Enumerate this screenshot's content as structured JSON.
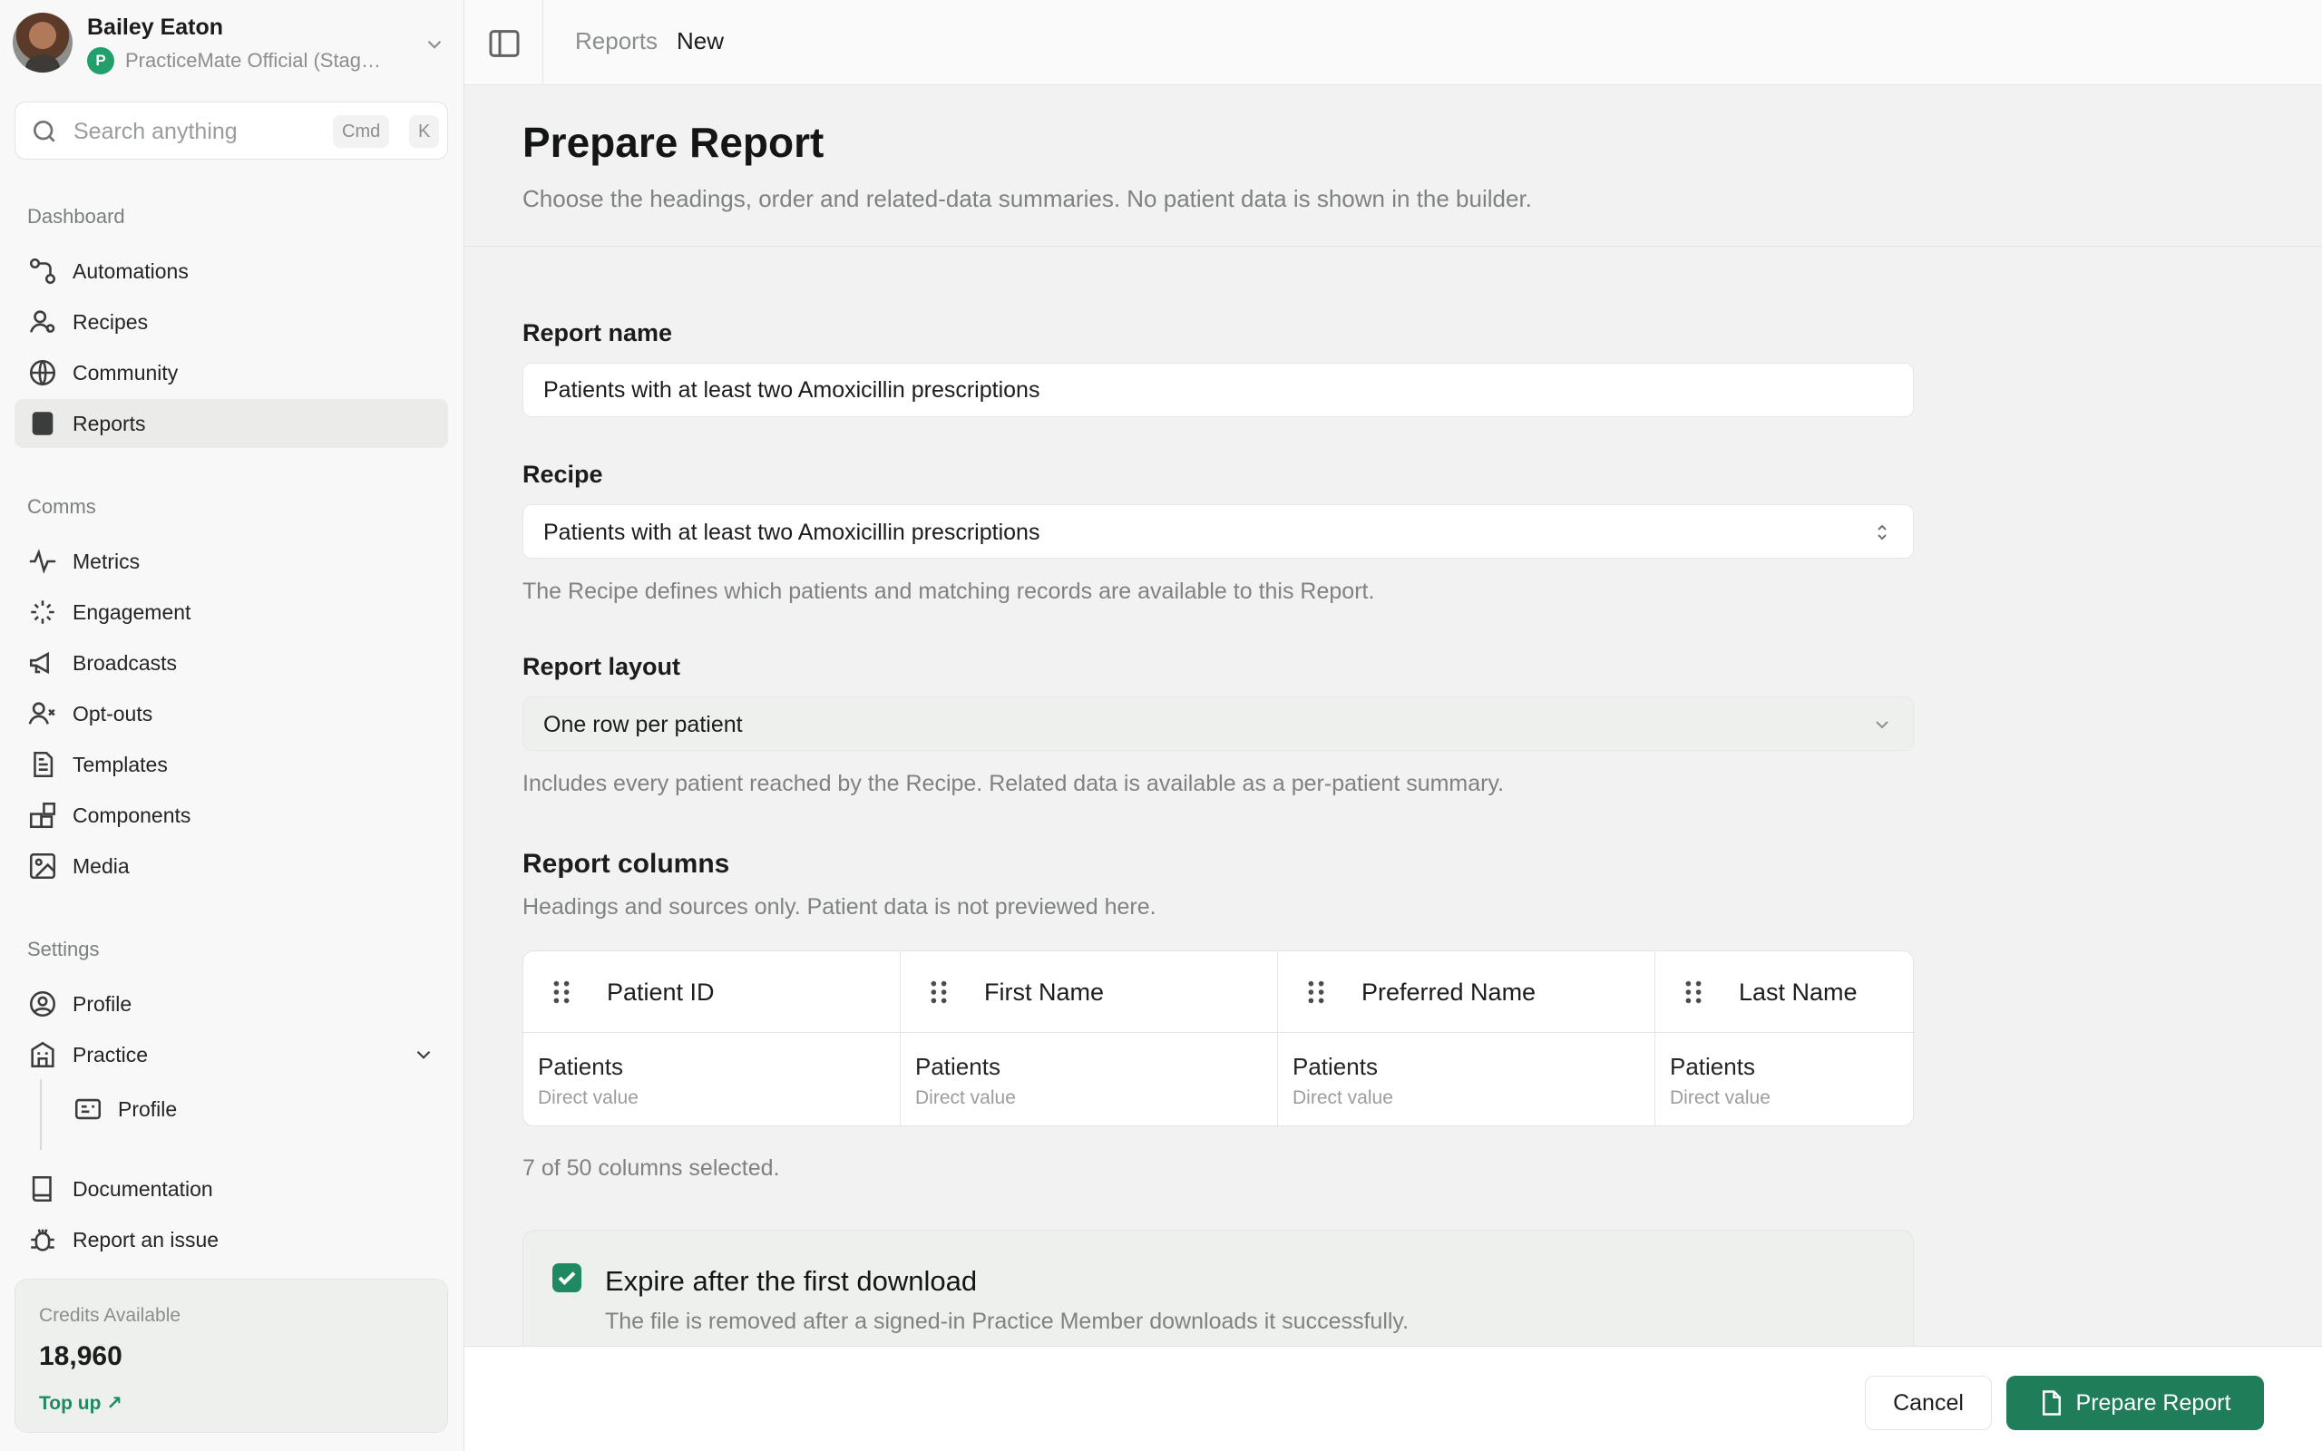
{
  "user": {
    "name": "Bailey Eaton",
    "practice": "PracticeMate Official (Stag…"
  },
  "search": {
    "placeholder": "Search anything",
    "shortcut_mod": "Cmd",
    "shortcut_key": "K"
  },
  "nav": {
    "dashboard_title": "Dashboard",
    "dashboard_items": [
      {
        "label": "Automations",
        "icon": "automations-icon"
      },
      {
        "label": "Recipes",
        "icon": "recipes-icon"
      },
      {
        "label": "Community",
        "icon": "globe-icon"
      },
      {
        "label": "Reports",
        "icon": "reports-icon",
        "active": true
      }
    ],
    "comms_title": "Comms",
    "comms_items": [
      {
        "label": "Metrics",
        "icon": "activity-icon"
      },
      {
        "label": "Engagement",
        "icon": "sparkle-icon"
      },
      {
        "label": "Broadcasts",
        "icon": "megaphone-icon"
      },
      {
        "label": "Opt-outs",
        "icon": "user-x-icon"
      },
      {
        "label": "Templates",
        "icon": "file-text-icon"
      },
      {
        "label": "Components",
        "icon": "blocks-icon"
      },
      {
        "label": "Media",
        "icon": "image-icon"
      }
    ],
    "settings_title": "Settings",
    "settings_items": [
      {
        "label": "Profile",
        "icon": "user-circle-icon"
      },
      {
        "label": "Practice",
        "icon": "building-icon"
      },
      {
        "label": "Profile",
        "icon": "id-card-icon"
      }
    ],
    "footer_items": [
      {
        "label": "Documentation",
        "icon": "book-icon"
      },
      {
        "label": "Report an issue",
        "icon": "bug-icon"
      }
    ]
  },
  "credits": {
    "label": "Credits Available",
    "value": "18,960",
    "topup": "Top up ↗"
  },
  "breadcrumb": {
    "parent": "Reports",
    "current": "New"
  },
  "page": {
    "title": "Prepare Report",
    "subtitle": "Choose the headings, order and related-data summaries. No patient data is shown in the builder."
  },
  "form": {
    "report_name_label": "Report name",
    "report_name_value": "Patients with at least two Amoxicillin prescriptions",
    "recipe_label": "Recipe",
    "recipe_value": "Patients with at least two Amoxicillin prescriptions",
    "recipe_help": "The Recipe defines which patients and matching records are available to this Report.",
    "layout_label": "Report layout",
    "layout_value": "One row per patient",
    "layout_help": "Includes every patient reached by the Recipe. Related data is available as a per-patient summary.",
    "columns_title": "Report columns",
    "columns_help": "Headings and sources only. Patient data is not previewed here.",
    "columns": [
      {
        "title": "Patient ID",
        "source": "Patients",
        "kind": "Direct value"
      },
      {
        "title": "First Name",
        "source": "Patients",
        "kind": "Direct value"
      },
      {
        "title": "Preferred Name",
        "source": "Patients",
        "kind": "Direct value"
      },
      {
        "title": "Last Name",
        "source": "Patients",
        "kind": "Direct value"
      }
    ],
    "columns_count": "7 of 50 columns selected.",
    "expire_title": "Expire after the first download",
    "expire_desc": "The file is removed after a signed-in Practice Member downloads it successfully.",
    "expire_checked": true
  },
  "footer": {
    "cancel_label": "Cancel",
    "submit_label": "Prepare Report"
  },
  "colors": {
    "accent": "#1f7d5a",
    "badge": "#22a06b"
  }
}
